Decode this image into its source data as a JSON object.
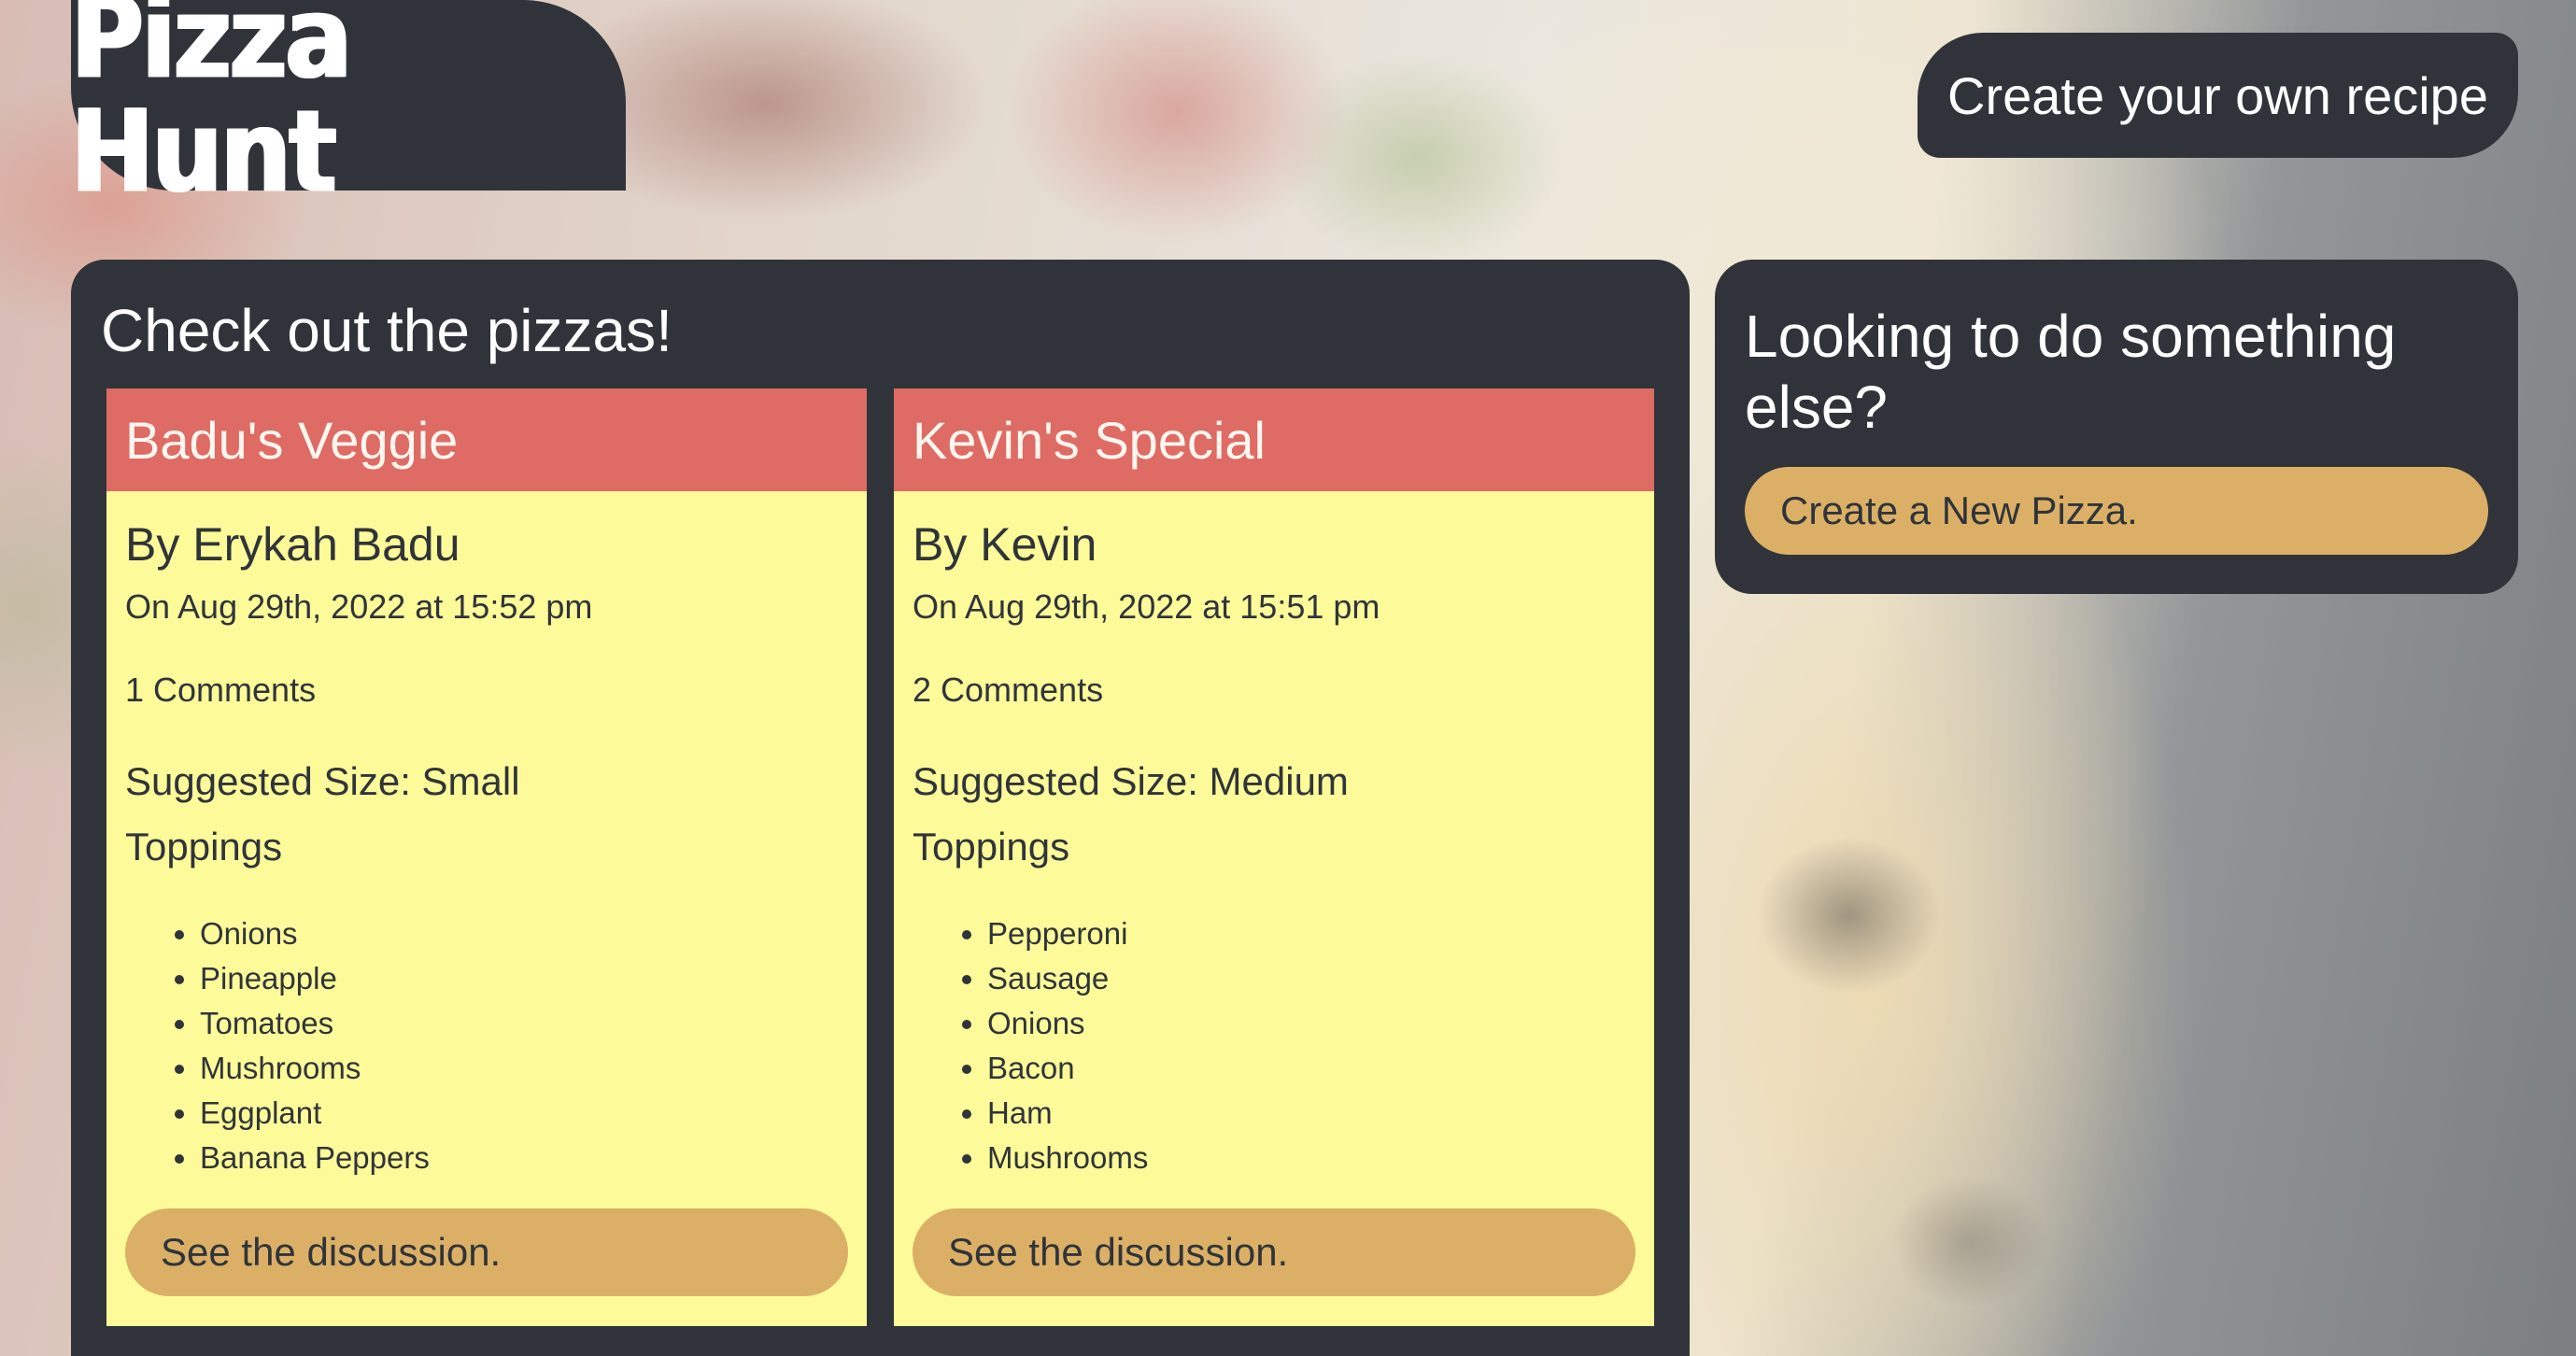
{
  "header": {
    "logo_text": "Pizza Hunt",
    "create_recipe_label": "Create your own recipe"
  },
  "main": {
    "title": "Check out the pizzas!",
    "pizzas": [
      {
        "name": "Badu's Veggie",
        "author": "By Erykah Badu",
        "date": "On Aug 29th, 2022 at 15:52 pm",
        "comments": "1 Comments",
        "suggested_size": "Suggested Size: Small",
        "toppings_label": "Toppings",
        "toppings": [
          "Onions",
          "Pineapple",
          "Tomatoes",
          "Mushrooms",
          "Eggplant",
          "Banana Peppers"
        ],
        "discussion_label": "See the discussion."
      },
      {
        "name": "Kevin's Special",
        "author": "By Kevin",
        "date": "On Aug 29th, 2022 at 15:51 pm",
        "comments": "2 Comments",
        "suggested_size": "Suggested Size: Medium",
        "toppings_label": "Toppings",
        "toppings": [
          "Pepperoni",
          "Sausage",
          "Onions",
          "Bacon",
          "Ham",
          "Mushrooms"
        ],
        "discussion_label": "See the discussion."
      }
    ]
  },
  "sidebar": {
    "title": "Looking to do something else?",
    "create_pizza_label": "Create a New Pizza."
  },
  "colors": {
    "panel": "#30343a",
    "card_header": "#de6b64",
    "card_body": "#fdfb99",
    "button": "#dbb066"
  }
}
